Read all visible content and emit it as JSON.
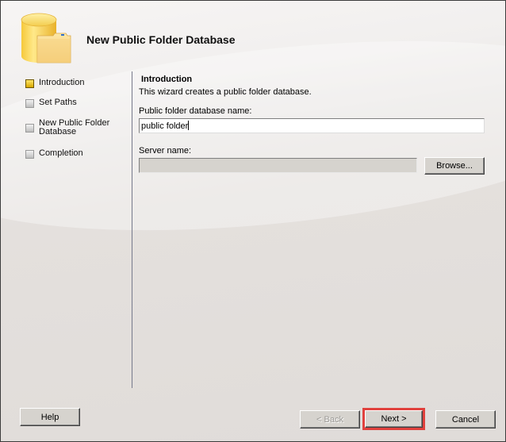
{
  "wizard": {
    "title": "New Public Folder Database",
    "header_icon": "database-folder-icon"
  },
  "steps": [
    {
      "label": "Introduction",
      "active": true
    },
    {
      "label": "Set Paths",
      "active": false
    },
    {
      "label": "New Public Folder Database",
      "label_line1": "New Public Folder",
      "label_line2": "Database",
      "active": false
    },
    {
      "label": "Completion",
      "active": false
    }
  ],
  "content": {
    "section_title": "Introduction",
    "description": "This wizard creates a public folder database.",
    "name_label": "Public folder database name:",
    "name_value": "public folder",
    "server_label": "Server name:",
    "server_value": "",
    "browse_label": "Browse..."
  },
  "footer": {
    "help_label": "Help",
    "back_label": "< Back",
    "next_label": "Next >",
    "cancel_label": "Cancel",
    "highlight_color": "#e0413d"
  }
}
